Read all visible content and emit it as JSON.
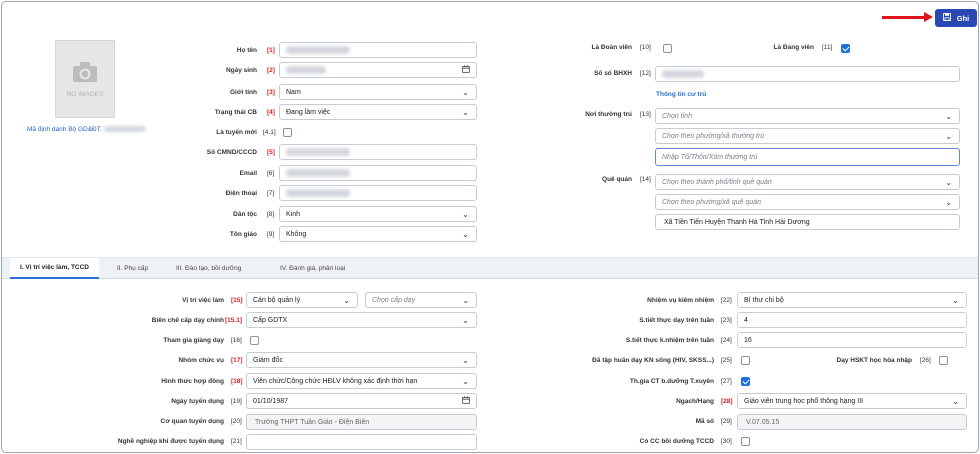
{
  "save_label": "Ghi",
  "photo_placeholder": "NO IMAGES",
  "id_label": "Mã định danh Bộ GD&ĐT:",
  "left_form": [
    {
      "label": "Họ tên",
      "num": "[1]",
      "required": true,
      "value": "",
      "type": "blurred"
    },
    {
      "label": "Ngày sinh",
      "num": "[2]",
      "required": true,
      "value": "",
      "type": "date"
    },
    {
      "label": "Giới tính",
      "num": "[3]",
      "required": true,
      "value": "Nam",
      "type": "select"
    },
    {
      "label": "Trạng thái CB",
      "num": "[4]",
      "required": true,
      "value": "Đang làm việc",
      "type": "select"
    },
    {
      "label": "Là tuyển mới",
      "num": "[4.1]",
      "required": false,
      "value": "",
      "type": "checkbox"
    },
    {
      "label": "Số CMND/CCCD",
      "num": "[5]",
      "required": true,
      "value": "",
      "type": "blurred"
    },
    {
      "label": "Email",
      "num": "[6]",
      "required": false,
      "value": "",
      "type": "blurred"
    },
    {
      "label": "Điện thoại",
      "num": "[7]",
      "required": false,
      "value": "",
      "type": "blurred"
    },
    {
      "label": "Dân tộc",
      "num": "[8]",
      "required": false,
      "value": "Kinh",
      "type": "select"
    },
    {
      "label": "Tôn giáo",
      "num": "[9]",
      "required": false,
      "value": "Không",
      "type": "select"
    }
  ],
  "right_top": {
    "doan_vien_label": "Là Đoàn viên",
    "doan_vien_num": "[10]",
    "doan_vien_checked": false,
    "dang_vien_label": "Là Đảng viên",
    "dang_vien_num": "[11]",
    "dang_vien_checked": true,
    "bhxh_label": "Số sổ BHXH",
    "bhxh_num": "[12]",
    "cu_tru_link": "Thông tin cư trú",
    "noi_thuong_tru_label": "Nơi thường trú",
    "noi_thuong_tru_num": "[13]",
    "province_placeholder": "Chọn tỉnh",
    "ward_placeholder": "Chọn theo phường/xã thường trú",
    "hamlet_placeholder": "Nhập Tổ/Thôn/Xóm thường trú",
    "que_quan_label": "Quê quán",
    "que_quan_num": "[14]",
    "qq_city_placeholder": "Chọn theo thành phố/tỉnh quê quán",
    "qq_ward_placeholder": "Chọn theo phường/xã quê quán",
    "qq_address": "Xã Tiền Tiến Huyện Thanh Hà Tỉnh Hải Dương"
  },
  "tabs": [
    "I. Vị trí việc làm, TCCD",
    "II. Phụ cấp",
    "III. Đào tạo, bồi dưỡng",
    "IV. Đánh giá, phân loại"
  ],
  "bottom_left": {
    "vitri_label": "Vị trí việc làm",
    "vitri_num": "[15]",
    "vitri_value": "Cán bộ quản lý",
    "capday_placeholder": "Chọn cấp dạy",
    "bienche_label": "Biên chế cấp dạy chính",
    "bienche_num": "[15.1]",
    "bienche_value": "Cấp GDTX",
    "thamgia_label": "Tham gia giảng dạy",
    "thamgia_num": "[16]",
    "nhomcv_label": "Nhóm chức vụ",
    "nhomcv_num": "[17]",
    "nhomcv_value": "Giám đốc",
    "hinhthuc_label": "Hình thức hợp đồng",
    "hinhthuc_num": "[18]",
    "hinhthuc_value": "Viên chức/Công chức HĐLV không xác định thời hạn",
    "ngaytd_label": "Ngày tuyển dụng",
    "ngaytd_num": "[19]",
    "ngaytd_value": "01/10/1987",
    "coquan_label": "Cơ quan tuyển dụng",
    "coquan_num": "[20]",
    "coquan_value": "Trường THPT Tuần Giáo - Điện Biên",
    "nghenghiep_label": "Nghề nghiệp khi được tuyển dụng",
    "nghenghiep_num": "[21]"
  },
  "bottom_right": {
    "nhiemvu_label": "Nhiệm vụ kiêm nhiệm",
    "nhiemvu_num": "[22]",
    "nhiemvu_value": "Bí thư chi bộ",
    "tietday_label": "S.tiết thực dạy trên tuần",
    "tietday_num": "[23]",
    "tietday_value": "4",
    "tietkn_label": "S.tiết thực k.nhiệm trên tuần",
    "tietkn_num": "[24]",
    "tietkn_value": "16",
    "taphuan_label": "Đã tập huấn dạy KN sống (HIV, SKSS...)",
    "taphuan_num": "[25]",
    "hoanhap_label": "Dạy HSKT học hòa nhập",
    "hoanhap_num": "[26]",
    "thgia_label": "Th.gia CT b.dưỡng T.xuyên",
    "thgia_num": "[27]",
    "ngach_label": "Ngạch/Hạng",
    "ngach_num": "[28]",
    "ngach_value": "Giáo viên trung học phổ thông hạng III",
    "maso_label": "Mã số",
    "maso_num": "[29]",
    "maso_value": "V.07.05.15",
    "cocc_label": "Có CC bồi dưỡng TCCD",
    "cocc_num": "[30]"
  },
  "colors": {
    "primary": "#2948b4",
    "required": "#e01a1a",
    "link": "#2a6fc8",
    "arrow": "#e0141c",
    "check": "#1f6fdc"
  }
}
